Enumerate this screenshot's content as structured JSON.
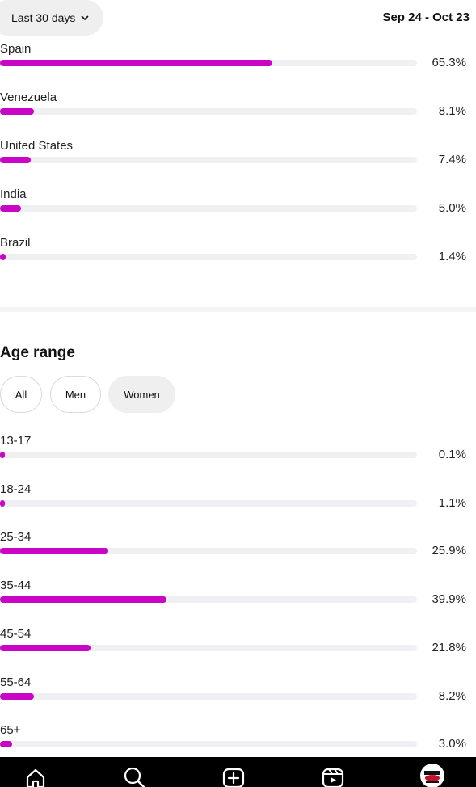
{
  "header": {
    "range_label": "Last 30 days",
    "date_range": "Sep 24 - Oct 23"
  },
  "countries": [
    {
      "label": "Spain",
      "value": "65.3%",
      "pct": 65.3
    },
    {
      "label": "Venezuela",
      "value": "8.1%",
      "pct": 8.1
    },
    {
      "label": "United States",
      "value": "7.4%",
      "pct": 7.4
    },
    {
      "label": "India",
      "value": "5.0%",
      "pct": 5.0
    },
    {
      "label": "Brazil",
      "value": "1.4%",
      "pct": 1.4
    }
  ],
  "age": {
    "title": "Age range",
    "filters": [
      "All",
      "Men",
      "Women"
    ],
    "selected_filter": "Women",
    "ranges": [
      {
        "label": "13-17",
        "value": "0.1%",
        "pct": 0.1
      },
      {
        "label": "18-24",
        "value": "1.1%",
        "pct": 1.1
      },
      {
        "label": "25-34",
        "value": "25.9%",
        "pct": 25.9
      },
      {
        "label": "35-44",
        "value": "39.9%",
        "pct": 39.9
      },
      {
        "label": "45-54",
        "value": "21.8%",
        "pct": 21.8
      },
      {
        "label": "55-64",
        "value": "8.2%",
        "pct": 8.2
      },
      {
        "label": "65+",
        "value": "3.0%",
        "pct": 3.0
      }
    ]
  },
  "nav": {
    "icons": [
      "home-icon",
      "search-icon",
      "create-icon",
      "reels-icon",
      "profile-avatar"
    ]
  },
  "colors": {
    "accent": "#c905c6",
    "track": "#f0f0f2",
    "nav_bg": "#000000"
  }
}
